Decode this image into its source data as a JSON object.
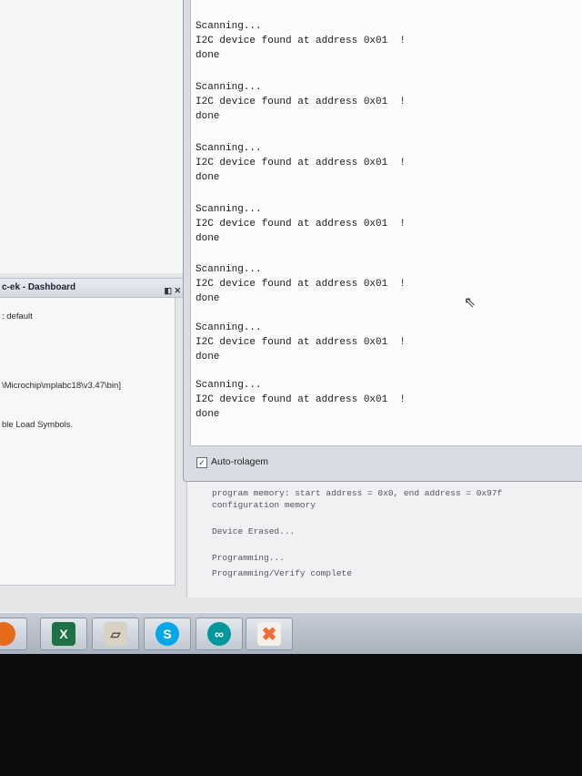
{
  "dashboard": {
    "title": "c-ek - Dashboard",
    "controls": "◧ ✕",
    "lines": [
      ": default",
      "\\Microchip\\mplabc18\\v3.47\\bin]",
      "ble Load Symbols."
    ]
  },
  "serial_monitor": {
    "blocks": [
      {
        "l1": "Scanning...",
        "l2": "I2C device found at address 0x01  !",
        "l3": "done"
      },
      {
        "l1": "Scanning...",
        "l2": "I2C device found at address 0x01  !",
        "l3": "done"
      },
      {
        "l1": "Scanning...",
        "l2": "I2C device found at address 0x01  !",
        "l3": "done"
      },
      {
        "l1": "Scanning...",
        "l2": "I2C device found at address 0x01  !",
        "l3": "done"
      },
      {
        "l1": "Scanning...",
        "l2": "I2C device found at address 0x01  !",
        "l3": "done"
      },
      {
        "l1": "Scanning...",
        "l2": "I2C device found at address 0x01  !",
        "l3": "done"
      },
      {
        "l1": "Scanning...",
        "l2": "I2C device found at address 0x01  !",
        "l3": "done"
      }
    ],
    "autoscroll_label": "Auto-rolagem",
    "autoscroll_checked": "✓"
  },
  "output": {
    "lines": [
      "program memory: start address = 0x0, end address = 0x97f",
      "configuration memory",
      "Device Erased...",
      "Programming...",
      "Programming/Verify complete"
    ]
  },
  "taskbar": {
    "apps": [
      {
        "name": "firefox-icon",
        "glyph": "",
        "color": "#e66a1c"
      },
      {
        "name": "excel-icon",
        "glyph": "X",
        "color": "#1e7145"
      },
      {
        "name": "book-icon",
        "glyph": "",
        "color": "#5a4a3a"
      },
      {
        "name": "skype-icon",
        "glyph": "S",
        "color": "#00a8e8"
      },
      {
        "name": "arduino-icon",
        "glyph": "∞",
        "color": "#00979c"
      },
      {
        "name": "xampp-icon",
        "glyph": "✖",
        "color": "#f26a37"
      }
    ]
  }
}
